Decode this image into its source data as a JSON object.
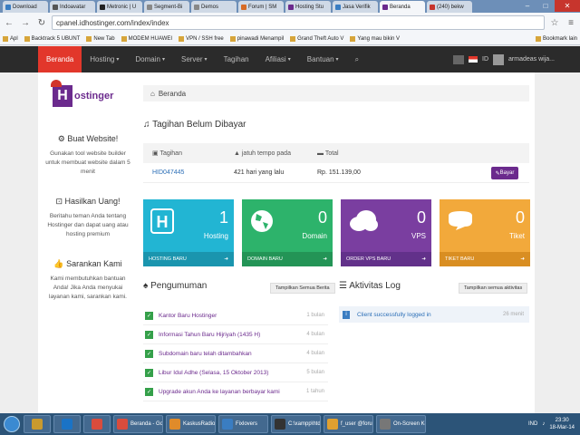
{
  "browser": {
    "tabs": [
      {
        "label": "Download",
        "color": "#3a7dc2"
      },
      {
        "label": "Indoavatar",
        "color": "#555"
      },
      {
        "label": "Metronic | U",
        "color": "#222"
      },
      {
        "label": "Segment-Bi",
        "color": "#888"
      },
      {
        "label": "Demos",
        "color": "#888"
      },
      {
        "label": "Forum | SM",
        "color": "#d76b25"
      },
      {
        "label": "Hosting Stu",
        "color": "#6b2a8d"
      },
      {
        "label": "Jasa Verifik",
        "color": "#3a7dc2"
      },
      {
        "label": "Beranda",
        "color": "#6b2a8d"
      },
      {
        "label": "(240) bekw",
        "color": "#c7352d"
      }
    ],
    "url": "cpanel.idhostinger.com/index/index",
    "bookmarks": [
      "Apl",
      "Backtrack 5 UBUNT",
      "New Tab",
      "MODEM HUAWEI",
      "VPN / SSH free",
      "pinawadi Menampil",
      "Grand Theft Auto V",
      "Yang mau bikin V"
    ],
    "other_bookmarks": "Bookmark lain"
  },
  "nav": {
    "items": [
      {
        "label": "Beranda",
        "caret": false
      },
      {
        "label": "Hosting",
        "caret": true
      },
      {
        "label": "Domain",
        "caret": true
      },
      {
        "label": "Server",
        "caret": true
      },
      {
        "label": "Tagihan",
        "caret": false
      },
      {
        "label": "Afiliasi",
        "caret": true
      },
      {
        "label": "Bantuan",
        "caret": true
      }
    ],
    "lang": "ID",
    "user": "armadeas wija..."
  },
  "sidebar": {
    "logo_letter": "H",
    "logo_text": "ostinger",
    "blocks": [
      {
        "title": "Buat Website!",
        "text": "Gunakan tool website builder untuk membuat website dalam 5 menit"
      },
      {
        "title": "Hasilkan Uang!",
        "text": "Beritahu teman Anda tentang Hostinger dan dapat uang atau hosting premium"
      },
      {
        "title": "Sarankan Kami",
        "text": "Kami membutuhkan bantuan Anda! Jika Anda menyukai layanan kami, sarankan kami."
      }
    ]
  },
  "main": {
    "breadcrumb": "Beranda",
    "bill_title": "Tagihan Belum Dibayar",
    "bill_headers": [
      "Tagihan",
      "jatuh tempo pada",
      "Total"
    ],
    "bill_row": {
      "id": "HID047445",
      "due": "421 hari yang lalu",
      "total": "Rp. 151.139,00",
      "pay": "Bayar"
    },
    "tiles": [
      {
        "num": "1",
        "label": "Hosting",
        "footer": "HOSTING BARU",
        "color": "#22b5d3",
        "footer_color": "#1a95ae"
      },
      {
        "num": "0",
        "label": "Domain",
        "footer": "DOMAIN BARU",
        "color": "#2db36b",
        "footer_color": "#239456"
      },
      {
        "num": "0",
        "label": "VPS",
        "footer": "ORDER VPS BARU",
        "color": "#7a3ea0",
        "footer_color": "#62318a"
      },
      {
        "num": "0",
        "label": "Tiket",
        "footer": "TIKET BARU",
        "color": "#f2a93b",
        "footer_color": "#d98e22"
      }
    ],
    "announcements_title": "Pengumuman",
    "announcements_button": "Tampilkan Semua Berita",
    "announcements": [
      {
        "text": "Kantor Baru Hostinger",
        "date": "1 bulan"
      },
      {
        "text": "Informasi Tahun Baru Hijriyah (1435 H)",
        "date": "4 bulan"
      },
      {
        "text": "Subdomain baru telah ditambahkan",
        "date": "4 bulan"
      },
      {
        "text": "Libur Idul Adhe (Selasa, 15 Oktober 2013)",
        "date": "5 bulan"
      },
      {
        "text": "Upgrade akun Anda ke layanan berbayar kami",
        "date": "1 tahun"
      }
    ],
    "log_title": "Aktivitas Log",
    "log_button": "Tampilkan semua aktivitas",
    "log_row": {
      "text": "Client successfully logged in",
      "date": "26 menit"
    }
  },
  "taskbar": {
    "items": [
      {
        "label": "",
        "color": "#c99a2e"
      },
      {
        "label": "",
        "color": "#1a73c6"
      },
      {
        "label": "",
        "color": "#d94c3d"
      },
      {
        "label": "Beranda - Goo",
        "color": "#d94c3d"
      },
      {
        "label": "KaskusRadio -",
        "color": "#e08b2a"
      },
      {
        "label": "Fixlovers",
        "color": "#3a7dc2"
      },
      {
        "label": "C:\\xampp\\htd",
        "color": "#333"
      },
      {
        "label": "f_user @forum",
        "color": "#e0a030"
      },
      {
        "label": "On-Screen Key",
        "color": "#777"
      }
    ],
    "lang": "IND",
    "time": "23:30",
    "date": "18-Mar-14"
  }
}
